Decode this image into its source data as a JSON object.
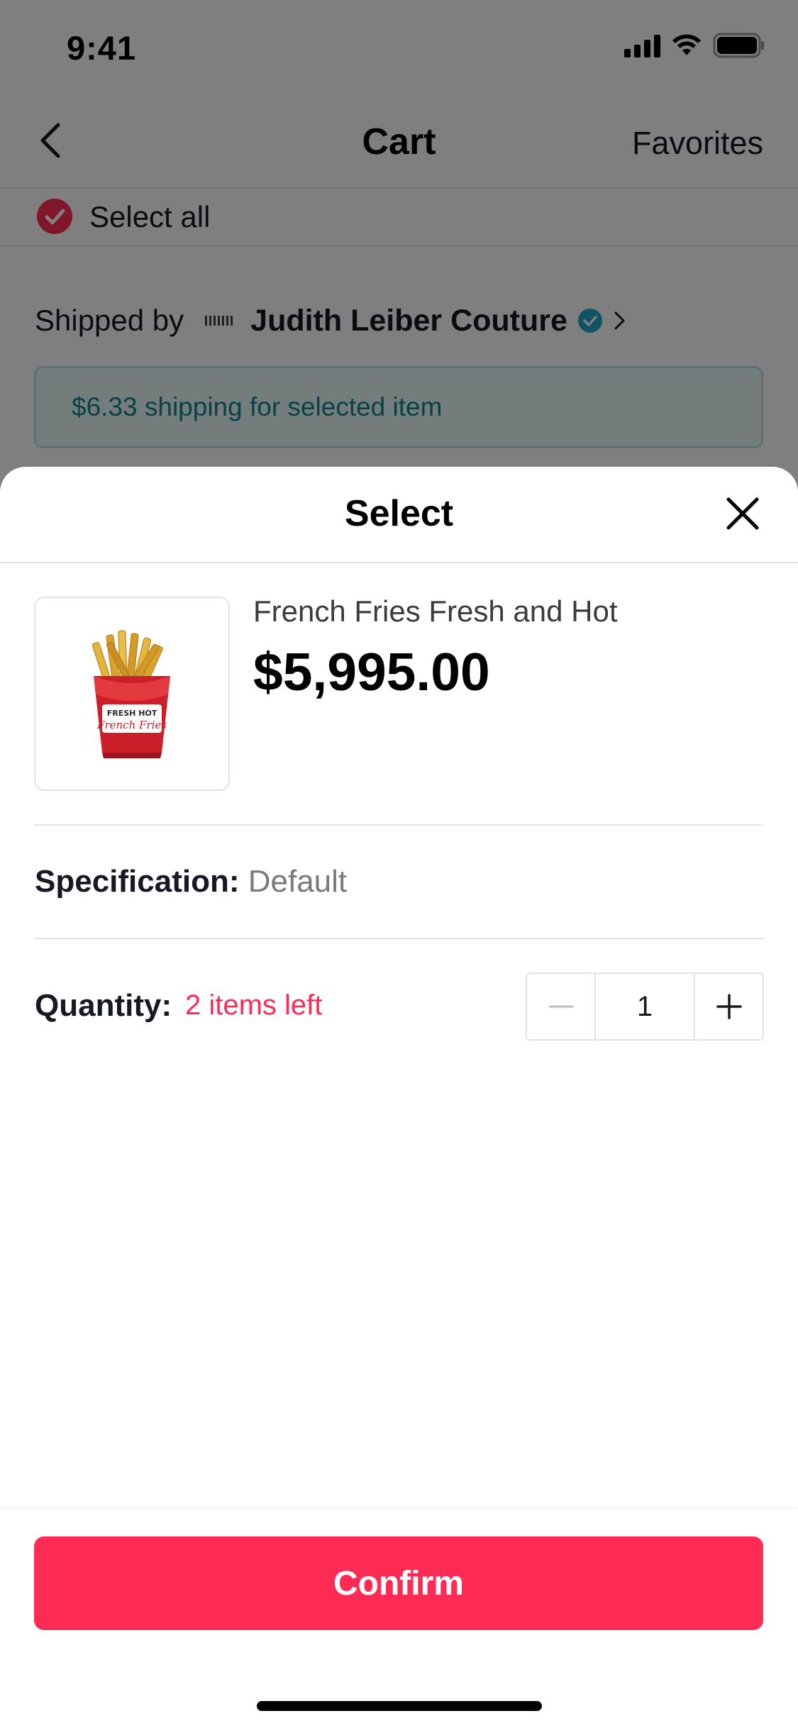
{
  "status_bar": {
    "time": "9:41"
  },
  "nav": {
    "title": "Cart",
    "favorites_label": "Favorites"
  },
  "select_all": {
    "label": "Select all",
    "checked": true
  },
  "shipping": {
    "shipped_by_label": "Shipped by",
    "store_name": "Judith Leiber Couture",
    "notice": "$6.33 shipping for selected item"
  },
  "sheet": {
    "title": "Select",
    "product": {
      "name": "French Fries Fresh and Hot",
      "price": "$5,995.00",
      "box_text": "FRESH HOT",
      "box_script": "French Fries"
    },
    "specification": {
      "label": "Specification:",
      "value": "Default"
    },
    "quantity": {
      "label": "Quantity:",
      "stock_note": "2 items left",
      "value": "1"
    },
    "confirm_label": "Confirm"
  },
  "colors": {
    "accent": "#fe2c55",
    "teal": "#13858c",
    "verified": "#20a7c4"
  }
}
